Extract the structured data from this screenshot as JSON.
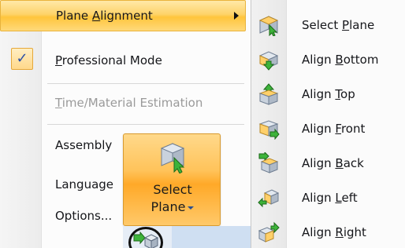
{
  "menu": {
    "items": [
      {
        "before": "Plane ",
        "key": "A",
        "after": "lignment",
        "state": "highlighted"
      },
      {
        "before": "",
        "key": "P",
        "after": "rofessional Mode",
        "state": "checked"
      },
      {
        "before": "",
        "key": "T",
        "after": "ime/Material Estimation",
        "state": "disabled"
      },
      {
        "before": "Assembly",
        "key": "",
        "after": "",
        "state": "normal"
      },
      {
        "before": "Language",
        "key": "",
        "after": "",
        "state": "normal"
      },
      {
        "before": "Options...",
        "key": "",
        "after": "",
        "state": "normal"
      }
    ],
    "check_mark": "✓"
  },
  "ribbon_button": {
    "line1": "Select",
    "line2": "Plane"
  },
  "submenu": {
    "items": [
      {
        "before": "Select ",
        "key": "P",
        "after": "lane",
        "icon": "select-plane-icon"
      },
      {
        "before": "Align ",
        "key": "B",
        "after": "ottom",
        "icon": "align-bottom-icon"
      },
      {
        "before": "Align ",
        "key": "T",
        "after": "op",
        "icon": "align-top-icon"
      },
      {
        "before": "Align ",
        "key": "F",
        "after": "ront",
        "icon": "align-front-icon"
      },
      {
        "before": "Align ",
        "key": "B",
        "after": "ack",
        "icon": "align-back-icon"
      },
      {
        "before": "Align ",
        "key": "L",
        "after": "eft",
        "icon": "align-left-icon"
      },
      {
        "before": "Align ",
        "key": "R",
        "after": "ight",
        "icon": "align-right-icon"
      }
    ]
  },
  "colors": {
    "highlight": "#ffc53c",
    "accent_blue": "#2a4fa8",
    "arrow_green": "#3db33a",
    "plane_grey": "#b9c3cf"
  }
}
